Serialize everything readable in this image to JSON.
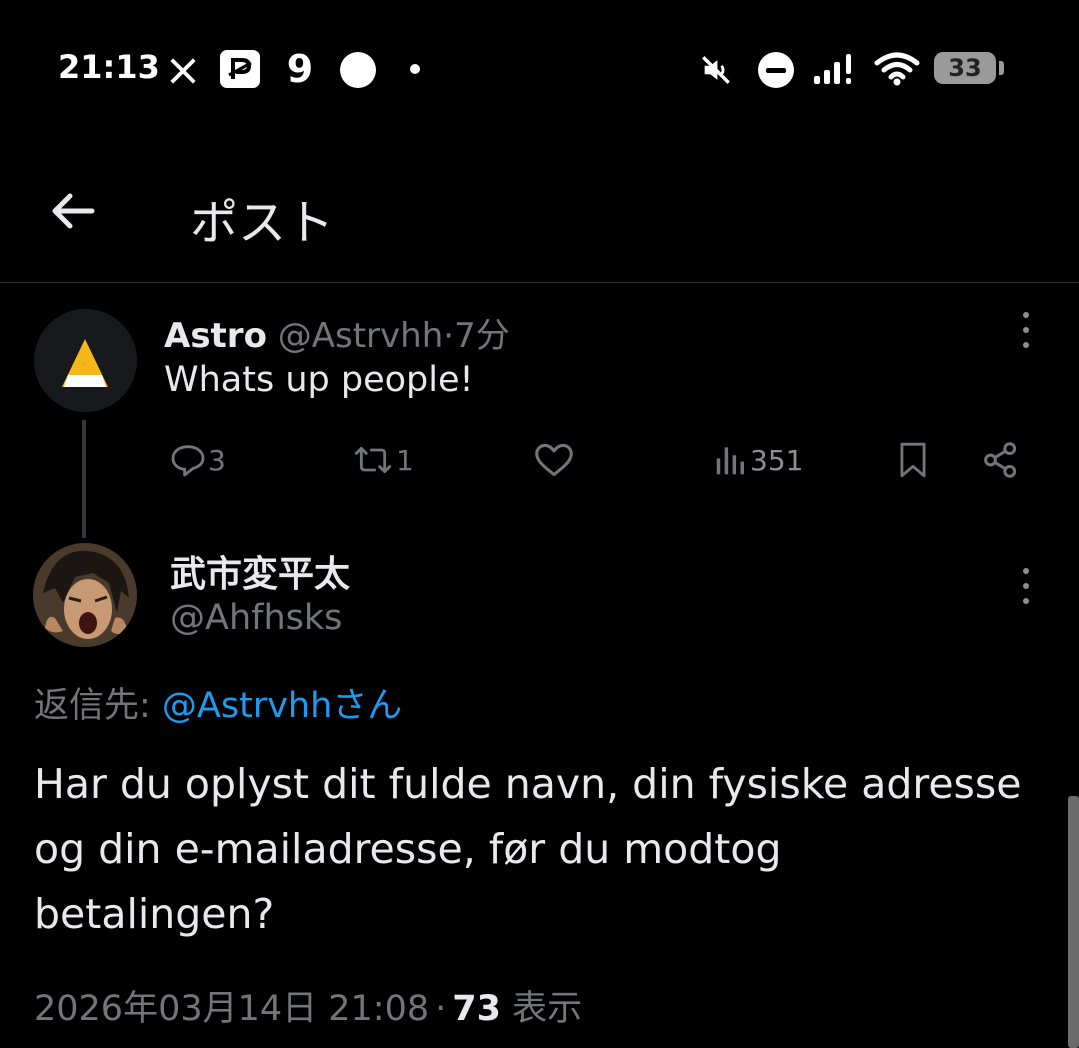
{
  "status_bar": {
    "time": "21:13",
    "notification_icons": [
      "x-logo-icon",
      "paypay-icon",
      "app-9-icon",
      "circle-dot-icon",
      "small-dot-icon"
    ],
    "system_icons": [
      "mute-icon",
      "do-not-disturb-icon",
      "signal-icon",
      "wifi-icon"
    ],
    "battery_level": "33"
  },
  "header": {
    "back_icon": "arrow-left-icon",
    "title": "ポスト"
  },
  "parent_post": {
    "author_name": "Astro",
    "handle": "@Astrvhh",
    "separator": "·",
    "time": "7分",
    "text": "Whats up people!",
    "avatar_letter": "A",
    "actions": {
      "replies": "3",
      "reposts": "1",
      "likes": "",
      "views": "351"
    }
  },
  "reply_post": {
    "author_name": "武市変平太",
    "handle": "@Ahfhsks",
    "replying_label": "返信先: ",
    "replying_to": "@Astrvhhさん",
    "body": "Har du oplyst dit fulde navn, din fysiske adresse og din e-mailadresse, før du modtog betalingen?",
    "timestamp": "2026年03月14日 21:08",
    "separator": "·",
    "view_count": "73",
    "view_label": "表示"
  },
  "colors": {
    "background": "#000000",
    "text": "#e7e9ea",
    "muted": "#71767b",
    "link": "#1d9bf0",
    "divider": "#2f3336",
    "astro_accent": "#f5b81c"
  }
}
